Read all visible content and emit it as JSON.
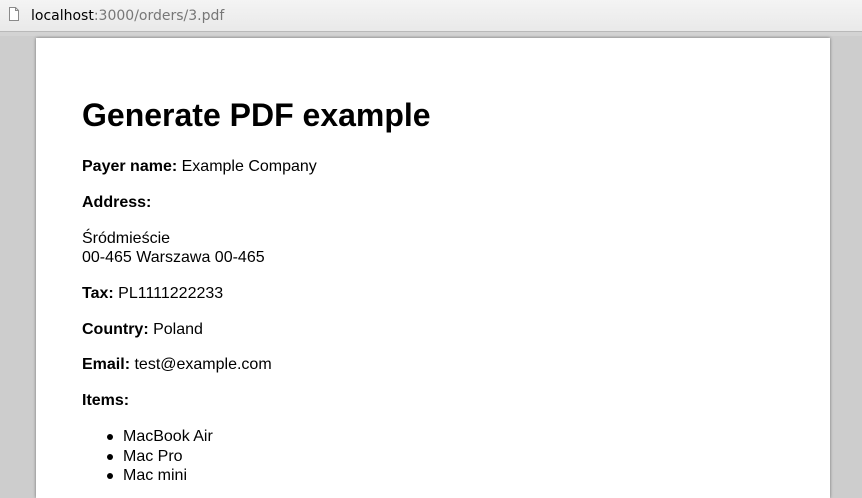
{
  "browser": {
    "url_host": "localhost",
    "url_rest": ":3000/orders/3.pdf"
  },
  "document": {
    "title": "Generate PDF example",
    "payer_label": "Payer name:",
    "payer_value": "Example Company",
    "address_label": "Address:",
    "address_line1": "Śródmieście",
    "address_line2": "00-465 Warszawa 00-465",
    "tax_label": "Tax:",
    "tax_value": "PL1111222233",
    "country_label": "Country:",
    "country_value": "Poland",
    "email_label": "Email:",
    "email_value": "test@example.com",
    "items_label": "Items:",
    "items": [
      "MacBook Air",
      "Mac Pro",
      "Mac mini"
    ]
  }
}
